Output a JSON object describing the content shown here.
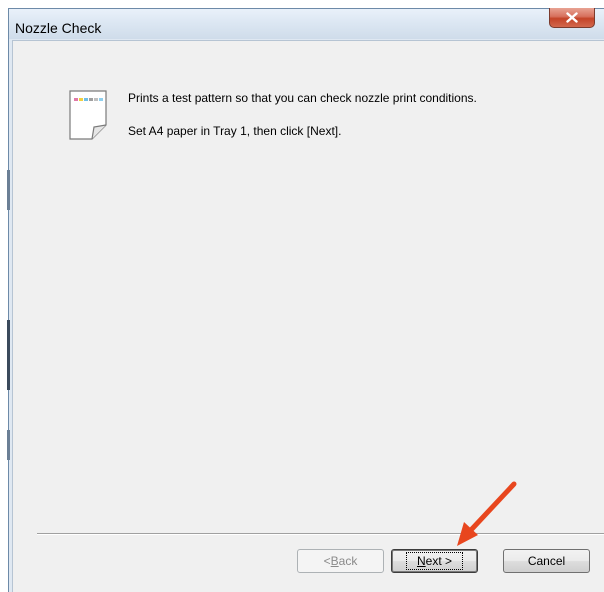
{
  "window": {
    "title": "Nozzle Check"
  },
  "message": {
    "line1": "Prints a test pattern so that you can check nozzle print conditions.",
    "line2": "Set A4 paper in Tray 1, then click [Next]."
  },
  "buttons": {
    "back_prefix": "< ",
    "back_hotkey": "B",
    "back_rest": "ack",
    "next_hotkey": "N",
    "next_rest": "ext >",
    "cancel_label": "Cancel"
  },
  "icons": {
    "document": "document-icon",
    "close": "close-icon",
    "annotation": "arrow-annotation-icon"
  },
  "colors": {
    "annotation_arrow": "#e8461e",
    "close_button": "#c44428",
    "dialog_background": "#f0f0f0"
  }
}
